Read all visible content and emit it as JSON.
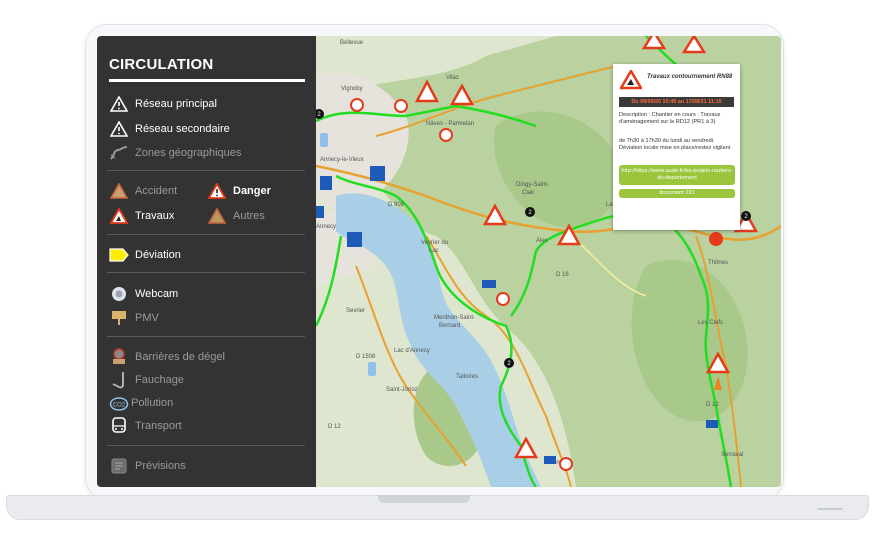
{
  "sidebar": {
    "title": "CIRCULATION",
    "items": [
      {
        "label": "Réseau principal",
        "icon": "warning-outline-icon",
        "active": true
      },
      {
        "label": "Réseau secondaire",
        "icon": "warning-outline-icon",
        "active": true
      },
      {
        "label": "Zones géographiques",
        "icon": "road-zone-icon",
        "active": false
      },
      {
        "label": "Accident",
        "icon": "accident-icon",
        "active": false
      },
      {
        "label": "Danger",
        "icon": "danger-icon",
        "active": true
      },
      {
        "label": "Travaux",
        "icon": "roadworks-icon",
        "active": true
      },
      {
        "label": "Autres",
        "icon": "other-warning-icon",
        "active": false
      },
      {
        "label": "Déviation",
        "icon": "deviation-icon",
        "active": true
      },
      {
        "label": "Webcam",
        "icon": "webcam-icon",
        "active": true
      },
      {
        "label": "PMV",
        "icon": "pmv-sign-icon",
        "active": false
      },
      {
        "label": "Barrières de dégel",
        "icon": "thaw-barrier-icon",
        "active": false
      },
      {
        "label": "Fauchage",
        "icon": "mowing-icon",
        "active": false
      },
      {
        "label": "Pollution",
        "icon": "co2-icon",
        "active": false
      },
      {
        "label": "Transport",
        "icon": "bus-icon",
        "active": false
      },
      {
        "label": "Prévisions",
        "icon": "forecast-icon",
        "active": false
      }
    ]
  },
  "popup": {
    "title": "Travaux contournement RN88",
    "date": "Du 08/09/20 10:45 au 17/08/21 11:15",
    "description": "Description : Chantier en cours : Travaux d'aménagement sur la RD12 (PR1 à 3)",
    "hours": "de 7h30 à 17h30 du lundi au vendredi. Déviation locale mise en place/restez vigilant",
    "link": "http://https://www.aude.fr/les-projets-routiers-du-departement",
    "document": "document 191"
  },
  "map_labels": [
    "Annecy-le-Vieux",
    "Annecy",
    "Vignoby",
    "Vilaz",
    "Nâves - Parmelan",
    "Dingy-Saint-Clair",
    "La Balme-de-Thuy",
    "Alex",
    "Veyrier du Lac",
    "Menthon-Saint-Bernard",
    "Talloires",
    "Sevrier",
    "Saint-Jorioz",
    "Lac d'Annecy",
    "Montmin",
    "Thônes",
    "Les Clefs",
    "Serraval",
    "D 909",
    "D 1508",
    "D 12",
    "D 16",
    "Bellevue"
  ],
  "colors": {
    "sidebar_bg": "#333333",
    "route_green": "#22dd22",
    "road_orange": "#e8a030",
    "lake": "#a9cfe6",
    "date_bg": "#3a3a3a",
    "date_text": "#ff6b3a",
    "button_green": "#9ac53d"
  }
}
